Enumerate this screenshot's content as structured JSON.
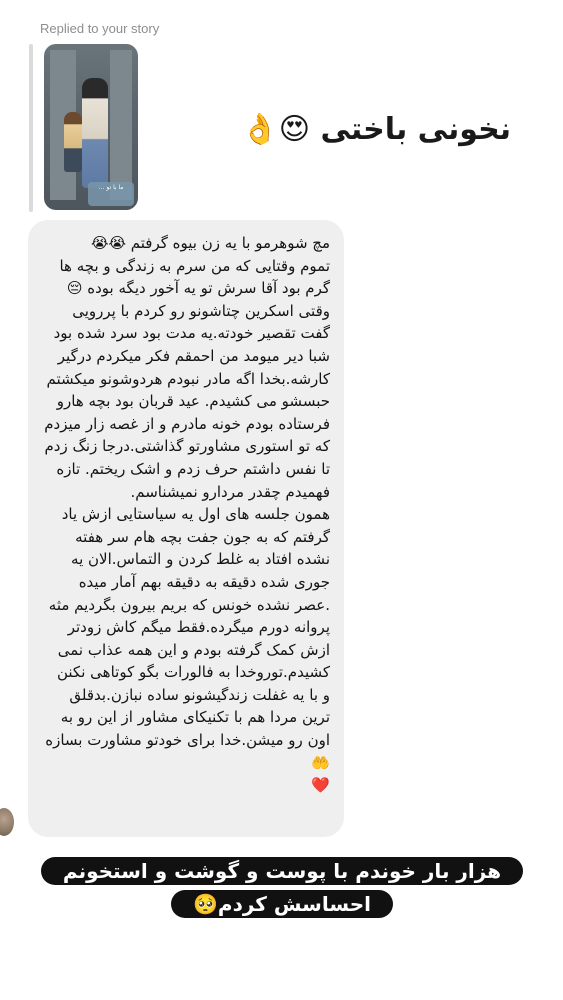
{
  "reply": {
    "label": "Replied to your story",
    "sticker_text": "… ما با تو"
  },
  "reaction": {
    "text": "نخونی باختی 😍👌"
  },
  "message": {
    "text": "مچ شوهرمو با یه زن بیوه گرفتم 😭😭\nتموم وقتایی که من سرم به زندگی و بچه ها گرم بود آقا سرش تو یه آخور دیگه بوده 😔\nوقتی اسکرین چتاشونو رو کردم با پررویی گفت تقصیر خودته.یه مدت بود سرد شده بود شبا دیر میومد من احمقم فکر میکردم درگیر کارشه.بخدا اگه مادر نبودم هردوشونو میکشتم حبسشو می کشیدم. عید قربان بود بچه هارو فرستاده بودم خونه مادرم و از غصه زار میزدم که تو استوری مشاورتو گذاشتی.درجا زنگ زدم تا نفس داشتم حرف زدم و اشک ریختم. تازه فهمیدم چقدر مردارو نمیشناسم.\nهمون جلسه های اول یه سیاستایی ازش یاد گرفتم که به جون جفت بچه هام سر هفته نشده افتاد به غلط کردن و التماس.الان یه جوری شده دقیقه به دقیقه بهم آمار میده .عصر نشده خونس که بریم بیرون بگردیم مثه پروانه دورم میگرده.فقط میگم کاش زودتر ازش کمک گرفته بودم و این همه عذاب نمی کشیدم.توروخدا به فالورات بگو کوتاهی نکنن  و با یه غفلت زندگیشونو ساده نبازن.بدقلق ترین مردا هم با تکنیکای مشاور از این رو به اون رو میشن.خدا برای خودتو مشاورت بسازه🤲\n❤️"
  },
  "caption": {
    "text": "هزار بار خوندم با پوست و گوشت و استخونم احساسش کردم🥺"
  }
}
